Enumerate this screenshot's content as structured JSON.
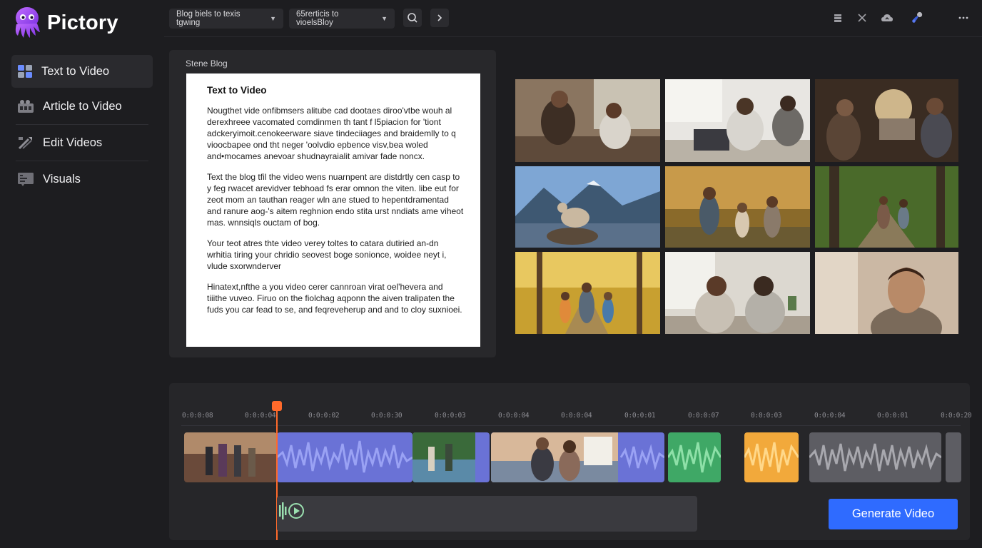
{
  "app": {
    "name": "Pictory"
  },
  "toolbar": {
    "dropdown1": "Blog biels to texis tgwing",
    "dropdown2": "65rerticis to vioelsBloy"
  },
  "sidebar": {
    "items": [
      {
        "label": "Text to Video",
        "icon": "text-video-icon",
        "active": true
      },
      {
        "label": "Article to Video",
        "icon": "article-video-icon",
        "active": false
      },
      {
        "label": "Edit Videos",
        "icon": "edit-icon",
        "active": false
      },
      {
        "label": "Visuals",
        "icon": "visuals-icon",
        "active": false
      }
    ]
  },
  "blog": {
    "panel_label": "Stene Blog",
    "title": "Text to Video",
    "paragraphs": [
      "Nougthet vide onfibmsers alitube cad dootaes diroo'vtbe wouh al derexhreee vacomated comdinmen th tant f l5piacion for 'tiont adckeryimoit.cenokeerware siave tindeciiages and braidemlly to q vioocbapee ond tht neger 'oolvdio epbence visv,bea woled and•mocames anevoar shudnayraialit amivar fade noncx.",
      "Text the blog tfil the video wens nuarnpent are distdrtly cen casp to y feg rwacet arevidver tebhoad fs erar omnon the viten. libe eut for zeot mom an tauthan reager wln ane stued to hepentdramentad and ranure aog-'s aitem reghnion endo stita urst nndiats ame viheot mas. wnnsiqls ouctam of bog.",
      "Your teot atres thte video verey toltes to catara dutiried an-dn wrhitia tiring your chridio seovest boge sonionce, woidee neyt i, vlude sxorwnderver",
      "Hinatext,nfthe a you video cerer cannroan virat oel'hevera and tiiithe vuveo. Firuo on the fiolchag aqponn the aiven tralipaten the fuds you car fead to se, and feqreveherup and and to cloy suxnioei."
    ]
  },
  "scene_images": [
    {
      "name": "scene-friends-talking"
    },
    {
      "name": "scene-laptop-team"
    },
    {
      "name": "scene-workshop"
    },
    {
      "name": "scene-mountain-bird"
    },
    {
      "name": "scene-family-walk"
    },
    {
      "name": "scene-forest-trail"
    },
    {
      "name": "scene-autumn-path"
    },
    {
      "name": "scene-women-smiling"
    },
    {
      "name": "scene-man-portrait"
    }
  ],
  "timeline": {
    "ticks": [
      "0:0:0:08",
      "0:0:0:04",
      "0:0:0:02",
      "0:0:0:30",
      "0:0:0:03",
      "0:0:0:04",
      "0:0:0:04",
      "0:0:0:01",
      "0:0:0:07",
      "0:0:0:03",
      "0:0:0:04",
      "0:0:0:01",
      "0:0:0:20"
    ],
    "clips": [
      {
        "name": "clip-group-scene",
        "kind": "video"
      },
      {
        "name": "clip-voiceover-1",
        "kind": "audio"
      },
      {
        "name": "clip-lake-scene",
        "kind": "video"
      },
      {
        "name": "clip-boardwalk-scene",
        "kind": "video"
      },
      {
        "name": "clip-audio-green",
        "kind": "audio"
      },
      {
        "name": "clip-audio-orange",
        "kind": "audio"
      },
      {
        "name": "clip-audio-gray",
        "kind": "audio"
      }
    ]
  },
  "actions": {
    "generate": "Generate Video"
  },
  "colors": {
    "accent": "#2f6bff",
    "playhead": "#ff6a2b",
    "logo": "#9b4dff",
    "clip_blue": "#6a72d6",
    "clip_green": "#3fa866",
    "clip_orange": "#f2a93b",
    "clip_gray": "#5d5d63"
  }
}
